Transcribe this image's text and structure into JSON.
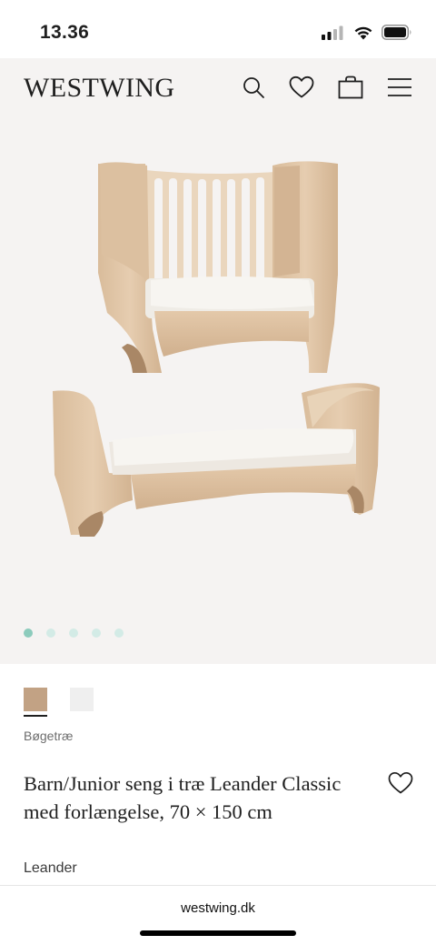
{
  "status_bar": {
    "time": "13.36",
    "signal_icon": "cellular-signal-icon",
    "wifi_icon": "wifi-icon",
    "battery_icon": "battery-icon"
  },
  "header": {
    "logo": "WESTWING",
    "icons": [
      "search-icon",
      "heart-icon",
      "shopping-bag-icon",
      "menu-icon"
    ]
  },
  "gallery": {
    "image_count": 5,
    "active_index": 0,
    "colors": {
      "background": "#f5f3f2",
      "dot_active": "#8ccbbc",
      "dot_inactive": "#d3ebe6"
    }
  },
  "product": {
    "swatches": [
      {
        "color": "#c2a284",
        "selected": true
      },
      {
        "color": "#efefef",
        "selected": false
      }
    ],
    "color_name": "Bøgetræ",
    "title": "Barn/Junior seng i træ Leander Classic med forlængelse, 70 × 150 cm",
    "brand": "Leander"
  },
  "browser": {
    "url": "westwing.dk"
  }
}
